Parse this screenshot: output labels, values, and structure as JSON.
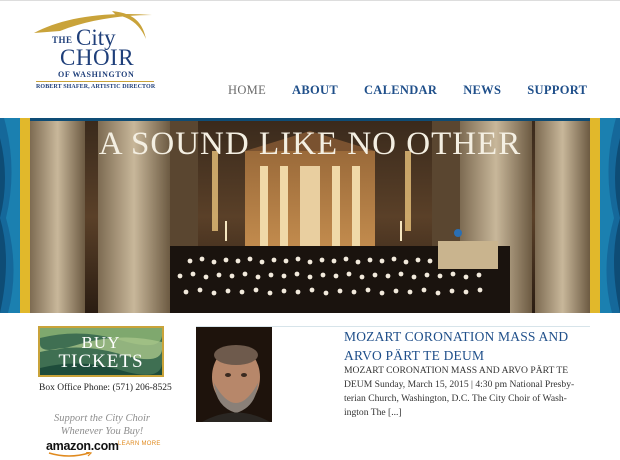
{
  "logo": {
    "the": "THE",
    "city": "City",
    "choir": "CHOIR",
    "of_washington": "OF WASHINGTON",
    "director": "ROBERT SHAFER, ARTISTIC DIRECTOR"
  },
  "nav": {
    "items": [
      {
        "label": "HOME",
        "active": true
      },
      {
        "label": "ABOUT",
        "active": false
      },
      {
        "label": "CALENDAR",
        "active": false
      },
      {
        "label": "NEWS",
        "active": false
      },
      {
        "label": "SUPPORT",
        "active": false
      }
    ]
  },
  "banner": {
    "title": "A SOUND LIKE NO OTHER"
  },
  "sidebar": {
    "buy_line1": "BUY",
    "buy_line2": "TICKETS",
    "box_office": "Box Office Phone: (571) 206-8525",
    "support_line1": "Support the City Choir",
    "support_line2": "Whenever You Buy!",
    "amazon": "amazon.com",
    "learn_more": "LEARN MORE"
  },
  "post": {
    "title": "MOZART CORONATION MASS AND ARVO PÄRT TE DEUM",
    "excerpt": "MOZART CORONATION MASS AND ARVO PÄRT TE DEUM Sunday, March 15, 2015 | 4:30 pm National Presby-terian Church, Washington, D.C. The City Choir of Wash-ington The [...]"
  },
  "colors": {
    "brand_blue": "#1f4f8a",
    "gold": "#c9a33a",
    "banner_blue": "#0e4c75",
    "amazon_orange": "#e08a1e"
  }
}
